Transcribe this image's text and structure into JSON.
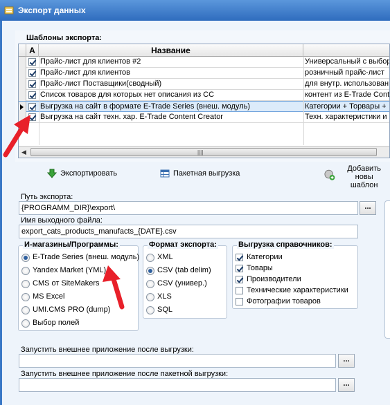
{
  "window": {
    "title": "Экспорт данных"
  },
  "templates": {
    "label": "Шаблоны экспорта:",
    "columns": {
      "active": "А",
      "name": "Название"
    },
    "rows": [
      {
        "name": "Прайс-лист для клиентов #2",
        "description": "Универсальный с выбор",
        "checked": true,
        "selected": false
      },
      {
        "name": "Прайс-лист для клиентов",
        "description": "розничный прайс-лист",
        "checked": true,
        "selected": false
      },
      {
        "name": "Прайс-лист Поставщики(сводный)",
        "description": "для внутр. использован",
        "checked": true,
        "selected": false
      },
      {
        "name": "Список товаров для которых нет описания из CC",
        "description": "контент из E-Trade Cont",
        "checked": true,
        "selected": false
      },
      {
        "name": "Выгрузка на сайт в формате E-Trade Series (внеш. модуль)",
        "description": "Категории + Торвары +",
        "checked": true,
        "selected": true
      },
      {
        "name": "Выгрузка на сайт техн. хар. E-Trade Content Creator",
        "description": "Техн. характеристики и",
        "checked": true,
        "selected": false
      }
    ]
  },
  "toolbar": {
    "export_label": "Экспортировать",
    "batch_label": "Пакетная выгрузка",
    "add_template_label_1": "Добавить новы",
    "add_template_label_2": "шаблон"
  },
  "export_path": {
    "label": "Путь экспорта:",
    "value": "{PROGRAMM_DIR}\\export\\",
    "browse": "..."
  },
  "output_file": {
    "label": "Имя выходного файла:",
    "value": "export_cats_products_manufacts_{DATE}.csv"
  },
  "shops": {
    "title": "И-магазины/Программы:",
    "options": [
      {
        "label": "E-Trade Series (внеш. модуль)",
        "checked": true
      },
      {
        "label": "Yandex Market (YML)",
        "checked": false
      },
      {
        "label": "CMS от SiteMakers",
        "checked": false
      },
      {
        "label": "MS Excel",
        "checked": false
      },
      {
        "label": "UMI.CMS PRO (dump)",
        "checked": false
      },
      {
        "label": "Выбор полей",
        "checked": false
      }
    ]
  },
  "formats": {
    "title": "Формат экспорта:",
    "options": [
      {
        "label": "XML",
        "checked": false
      },
      {
        "label": "CSV (tab delim)",
        "checked": true
      },
      {
        "label": "CSV (универ.)",
        "checked": false
      },
      {
        "label": "XLS",
        "checked": false
      },
      {
        "label": "SQL",
        "checked": false
      }
    ]
  },
  "references": {
    "title": "Выгрузка справочников:",
    "options": [
      {
        "label": "Категории",
        "checked": true
      },
      {
        "label": "Товары",
        "checked": true
      },
      {
        "label": "Производители",
        "checked": true
      },
      {
        "label": "Технические характеристики",
        "checked": false
      },
      {
        "label": "Фотографии товаров",
        "checked": false
      }
    ]
  },
  "run_after": {
    "label": "Запустить внешнее приложение после выгрузки:",
    "value": "",
    "browse": "..."
  },
  "run_after_batch": {
    "label": "Запустить внешнее приложение после пакетной выгрузки:",
    "value": "",
    "browse": "..."
  },
  "colors": {
    "title_bar": "#2f6cbe",
    "annotation_arrow": "#e8202a",
    "selection": "#dcebfa"
  }
}
